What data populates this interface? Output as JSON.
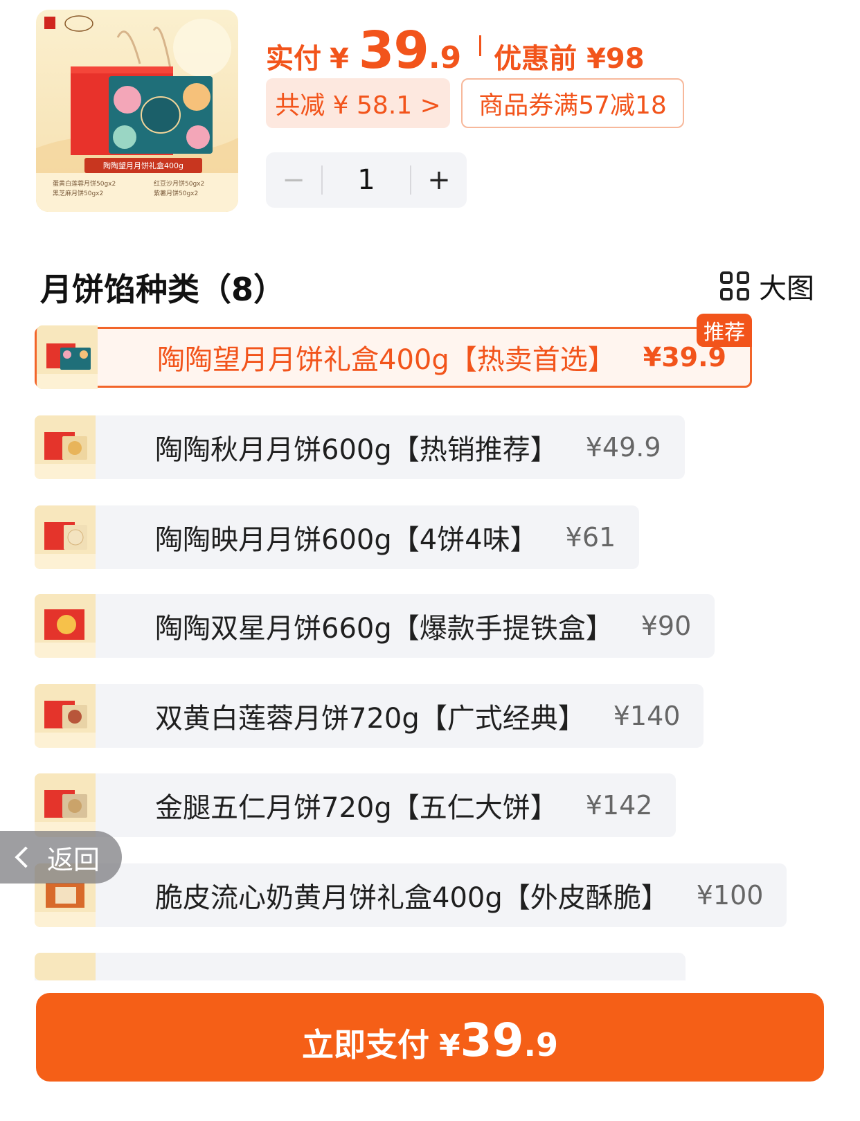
{
  "product": {
    "image_caption": "陶陶望月月饼礼盒400g",
    "image_lines": [
      "蛋黄白莲蓉月饼50gx2",
      "红豆沙月饼50gx2",
      "黑芝麻月饼50gx2",
      "紫薯月饼50gx2"
    ],
    "pay_label": "实付",
    "currency": "¥",
    "price_int": "39",
    "price_dec": ".9",
    "orig_price": "优惠前 ¥98",
    "discount_chip": "共减 ¥ 58.1 >",
    "coupon_chip": "商品券满57减18",
    "quantity": "1",
    "minus": "−",
    "plus": "+"
  },
  "section": {
    "title": "月饼馅种类（8）",
    "view_label": "大图"
  },
  "options": [
    {
      "name": "陶陶望月月饼礼盒400g【热卖首选】",
      "price": "¥39.9",
      "badge": "推荐"
    },
    {
      "name": "陶陶秋月月饼600g【热销推荐】",
      "price": "¥49.9"
    },
    {
      "name": "陶陶映月月饼600g【4饼4味】",
      "price": "¥61"
    },
    {
      "name": "陶陶双星月饼660g【爆款手提铁盒】",
      "price": "¥90"
    },
    {
      "name": "双黄白莲蓉月饼720g【广式经典】",
      "price": "¥140"
    },
    {
      "name": "金腿五仁月饼720g【五仁大饼】",
      "price": "¥142"
    },
    {
      "name": "脆皮流心奶黄月饼礼盒400g【外皮酥脆】",
      "price": "¥100"
    }
  ],
  "back": {
    "label": "返回"
  },
  "pay_button": {
    "label": "立即支付",
    "currency": "¥",
    "price_int": "39",
    "price_dec": ".9"
  },
  "colors": {
    "accent": "#f2541b",
    "button": "#f55f17",
    "chip_bg": "#fde8df"
  }
}
